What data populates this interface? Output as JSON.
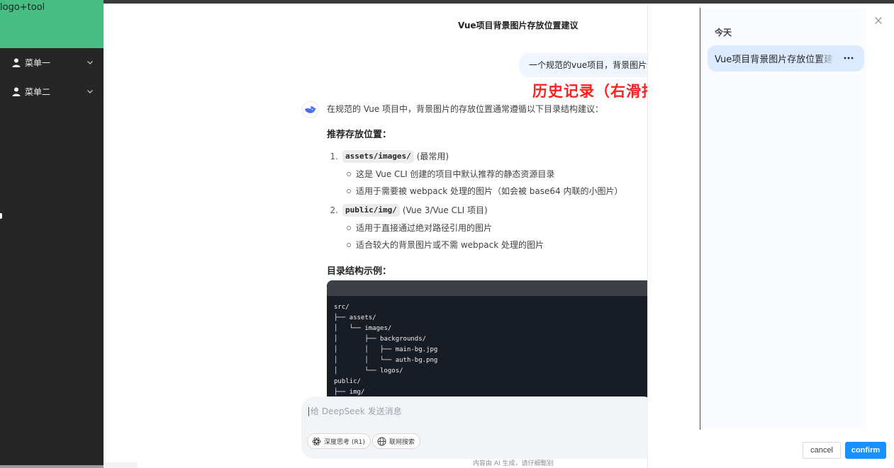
{
  "sidebar": {
    "logo": "logo+tool",
    "menu": [
      {
        "label": "菜单一"
      },
      {
        "label": "菜单二"
      }
    ]
  },
  "chat": {
    "title": "Vue项目背景图片存放位置建议",
    "user_message": "一个规范的vue项目，背景图片该放在哪",
    "annotation": "历史记录（右滑抽屉）",
    "answer": {
      "intro": "在规范的 Vue 项目中，背景图片的存放位置通常遵循以下目录结构建议：",
      "section1": "推荐存放位置：",
      "items": [
        {
          "num": "1.",
          "code": "assets/images/",
          "note": "(最常用)",
          "subs": [
            "这是 Vue CLI 创建的项目中默认推荐的静态资源目录",
            "适用于需要被 webpack 处理的图片（如会被 base64 内联的小图片）"
          ]
        },
        {
          "num": "2.",
          "code": "public/img/",
          "note": "(Vue 3/Vue CLI 项目)",
          "subs": [
            "适用于直接通过绝对路径引用的图片",
            "适合较大的背景图片或不需 webpack 处理的图片"
          ]
        }
      ],
      "section2": "目录结构示例：",
      "code_lines": [
        "src/",
        "├── assets/",
        "│   └── images/",
        "│       ├── backgrounds/",
        "│       │   ├── main-bg.jpg",
        "│       │   └── auth-bg.png",
        "│       └── logos/",
        "public/",
        "├── img/"
      ]
    },
    "input": {
      "placeholder": "给 DeepSeek 发送消息",
      "deep_think": "深度思考 (R1)",
      "web_search": "联网搜索"
    },
    "footnote": "内容由 AI 生成，请仔细甄别"
  },
  "drawer": {
    "heading": "今天",
    "history": [
      {
        "title": "Vue项目背景图片存放位置建议"
      }
    ],
    "cancel": "cancel",
    "confirm": "confirm"
  },
  "colors": {
    "sidebar_bg": "#262626",
    "logo_bg": "#46bd81",
    "accent": "#1890ff",
    "annotation": "#ff1f1f"
  }
}
